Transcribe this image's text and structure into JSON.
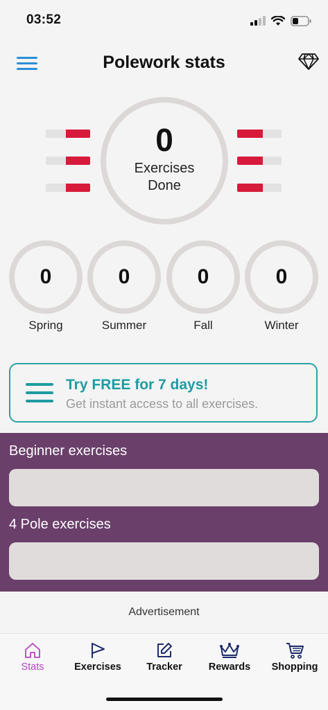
{
  "status_bar": {
    "time": "03:52",
    "icons": [
      "signal-icon",
      "wifi-icon",
      "battery-icon"
    ]
  },
  "header": {
    "title": "Polework stats",
    "menu_icon": "hamburger-menu-icon",
    "premium_icon": "diamond-icon"
  },
  "stats": {
    "total_value": "0",
    "total_label": "Exercises Done",
    "seasons": [
      {
        "label": "Spring",
        "value": "0"
      },
      {
        "label": "Summer",
        "value": "0"
      },
      {
        "label": "Fall",
        "value": "0"
      },
      {
        "label": "Winter",
        "value": "0"
      }
    ]
  },
  "promo": {
    "title": "Try FREE for 7 days!",
    "subtitle": "Get instant access to all exercises."
  },
  "sections": [
    {
      "title": "Beginner exercises"
    },
    {
      "title": "4 Pole exercises"
    }
  ],
  "advertisement": {
    "label": "Advertisement"
  },
  "tabs": [
    {
      "label": "Stats",
      "icon": "home-icon",
      "active": true
    },
    {
      "label": "Exercises",
      "icon": "flag-icon",
      "active": false
    },
    {
      "label": "Tracker",
      "icon": "edit-icon",
      "active": false
    },
    {
      "label": "Rewards",
      "icon": "crown-icon",
      "active": false
    },
    {
      "label": "Shopping",
      "icon": "cart-icon",
      "active": false
    }
  ],
  "colors": {
    "accent_blue": "#2a8fd8",
    "teal": "#1e9ba1",
    "purple_section": "#6a3f6a",
    "active_tab": "#b444c0",
    "pole_red": "#d7193a",
    "ring_gray": "#ddd8d8"
  }
}
